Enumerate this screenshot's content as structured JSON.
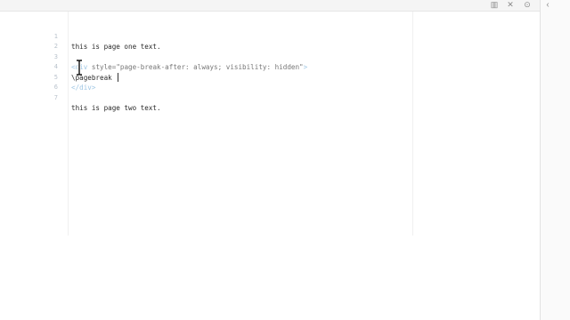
{
  "window": {
    "controls": [
      {
        "name": "layout-icon",
        "glyph": "▥"
      },
      {
        "name": "close-icon",
        "glyph": "✕"
      },
      {
        "name": "pin-icon",
        "glyph": "⊙"
      }
    ],
    "collapse_glyph": "‹"
  },
  "editor": {
    "lines": [
      {
        "num": "1",
        "text": "this is page one text."
      },
      {
        "num": "2",
        "text": ""
      },
      {
        "num": "3",
        "tag_open": "<div",
        "attr": " style=",
        "str": "\"page-break-after: always; visibility: hidden\"",
        "tag_close": ">"
      },
      {
        "num": "4",
        "text": "\\pagebreak "
      },
      {
        "num": "5",
        "tag": "</div>"
      },
      {
        "num": "6",
        "text": ""
      },
      {
        "num": "7",
        "text": "this is page two text."
      }
    ]
  },
  "colors": {
    "line_number": "#b9c2cc",
    "tag": "#a0c7e4",
    "text": "#2a2a2a"
  }
}
